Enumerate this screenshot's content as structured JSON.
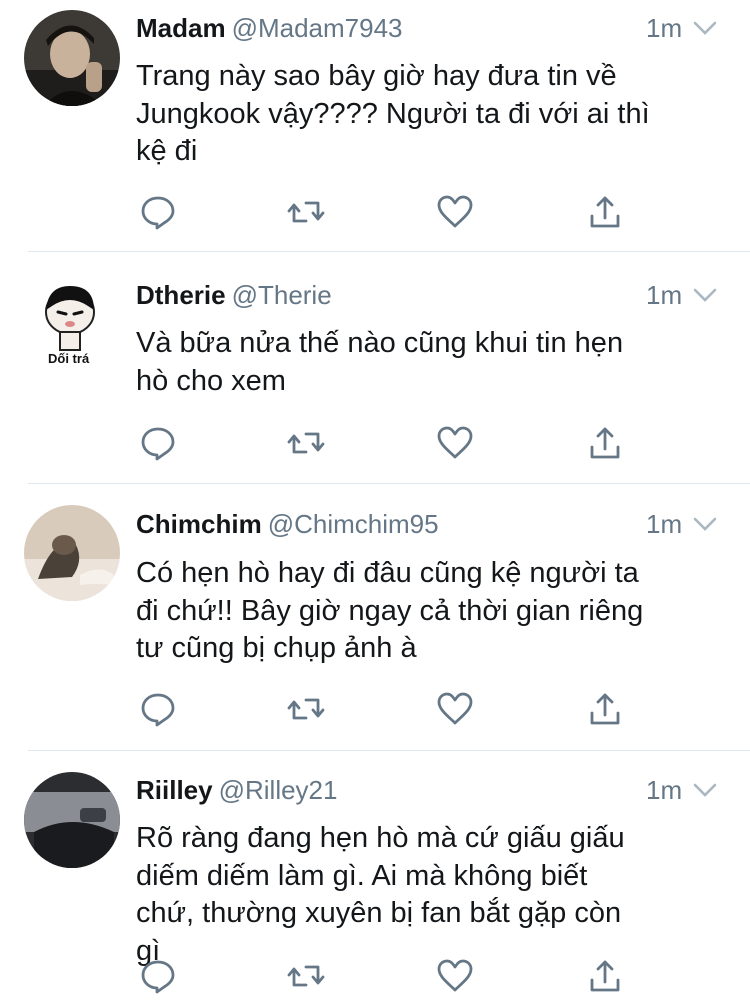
{
  "tweets": [
    {
      "name": "Madam",
      "handle": "@Madam7943",
      "time": "1m",
      "lines": [
        "Trang này sao bây giờ hay đưa tin về",
        "Jungkook vậy???? Người ta đi với ai thì",
        "kệ đi"
      ],
      "avatar": "dark-photo"
    },
    {
      "name": "Dtherie",
      "handle": "@Therie",
      "time": "1m",
      "lines": [
        "Và bữa nửa thế nào cũng khui tin hẹn",
        "hò cho xem"
      ],
      "avatar": "cartoon",
      "avatar_caption": "Dối trá"
    },
    {
      "name": "Chimchim",
      "handle": "@Chimchim95",
      "time": "1m",
      "lines": [
        "Có hẹn hò hay đi đâu cũng kệ người ta",
        "đi chứ!! Bây giờ ngay cả thời gian riêng",
        "tư cũng bị chụp ảnh à"
      ],
      "avatar": "beige-photo"
    },
    {
      "name": "Riilley",
      "handle": "@Rilley21",
      "time": "1m",
      "lines": [
        "Rõ ràng đang hẹn hò mà cứ giấu giấu",
        "diếm diếm làm gì. Ai mà không biết",
        "chứ, thường xuyên bị fan bắt gặp còn",
        "gì"
      ],
      "avatar": "car-photo"
    }
  ],
  "icons": {
    "reply": "speech-bubble-icon",
    "retweet": "retweet-icon",
    "like": "heart-icon",
    "share": "share-icon",
    "menu": "chevron-down-icon"
  },
  "colors": {
    "icon_gray": "#657786",
    "divider": "#e1e8ed",
    "text": "#14171a"
  }
}
